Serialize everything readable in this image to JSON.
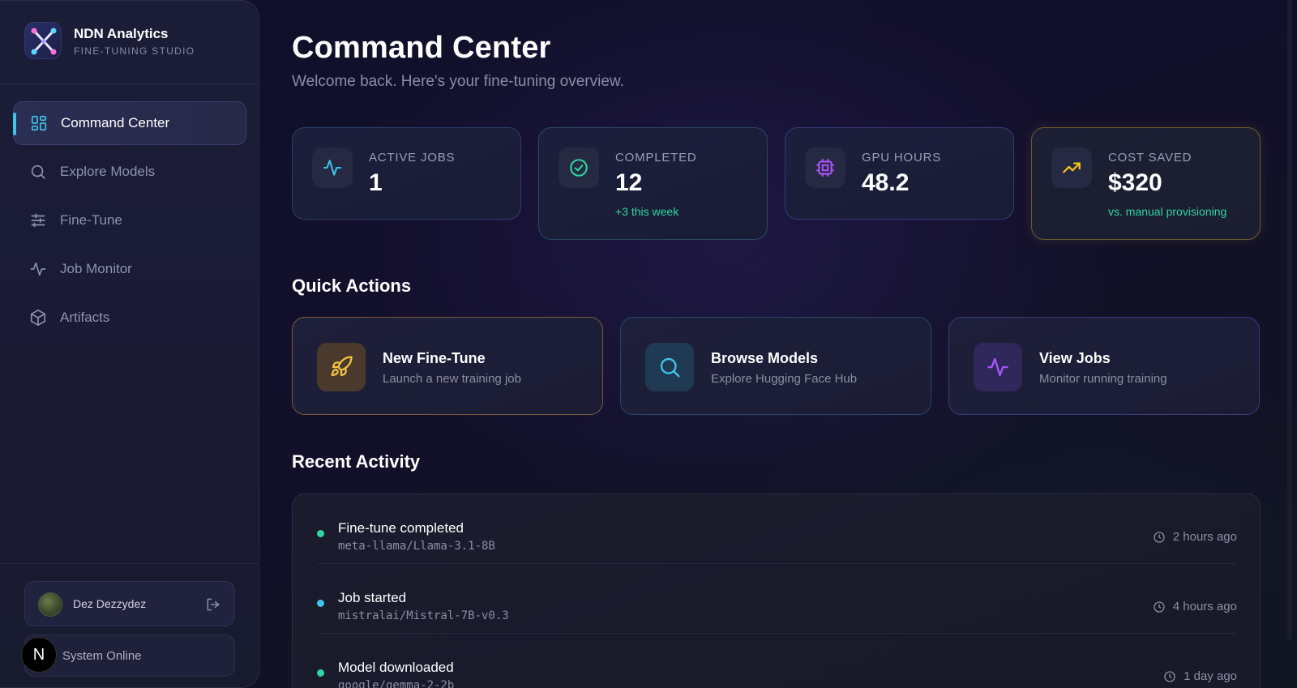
{
  "brand": {
    "title": "NDN Analytics",
    "subtitle": "FINE-TUNING STUDIO"
  },
  "nav": {
    "items": [
      {
        "label": "Command Center",
        "icon": "grid-icon",
        "active": true
      },
      {
        "label": "Explore Models",
        "icon": "search-icon",
        "active": false
      },
      {
        "label": "Fine-Tune",
        "icon": "sliders-icon",
        "active": false
      },
      {
        "label": "Job Monitor",
        "icon": "activity-icon",
        "active": false
      },
      {
        "label": "Artifacts",
        "icon": "box-icon",
        "active": false
      }
    ]
  },
  "user": {
    "name": "Dez Dezzydez"
  },
  "status": {
    "text": "System Online",
    "badge": "N"
  },
  "header": {
    "title": "Command Center",
    "subtitle": "Welcome back. Here's your fine-tuning overview."
  },
  "stats": [
    {
      "label": "ACTIVE JOBS",
      "value": "1",
      "note": "",
      "icon": "activity-icon",
      "color": "#3fc4ea"
    },
    {
      "label": "COMPLETED",
      "value": "12",
      "note": "+3 this week",
      "icon": "check-circle-icon",
      "color": "#2ed6a0"
    },
    {
      "label": "GPU HOURS",
      "value": "48.2",
      "note": "",
      "icon": "cpu-icon",
      "color": "#a855f7"
    },
    {
      "label": "COST SAVED",
      "value": "$320",
      "note": "vs. manual provisioning",
      "icon": "trending-up-icon",
      "color": "#facc15"
    }
  ],
  "quick_actions": {
    "title": "Quick Actions",
    "items": [
      {
        "title": "New Fine-Tune",
        "subtitle": "Launch a new training job",
        "icon": "rocket-icon",
        "color": "#f5c242"
      },
      {
        "title": "Browse Models",
        "subtitle": "Explore Hugging Face Hub",
        "icon": "search-icon",
        "color": "#3fc4ea"
      },
      {
        "title": "View Jobs",
        "subtitle": "Monitor running training",
        "icon": "activity-icon",
        "color": "#a855f7"
      }
    ]
  },
  "recent_activity": {
    "title": "Recent Activity",
    "items": [
      {
        "title": "Fine-tune completed",
        "model": "meta-llama/Llama-3.1-8B",
        "time": "2 hours ago",
        "dot_color": "#2ed6a0"
      },
      {
        "title": "Job started",
        "model": "mistralai/Mistral-7B-v0.3",
        "time": "4 hours ago",
        "dot_color": "#3fc4ea"
      },
      {
        "title": "Model downloaded",
        "model": "google/gemma-2-2b",
        "time": "1 day ago",
        "dot_color": "#2ed6a0"
      }
    ]
  }
}
